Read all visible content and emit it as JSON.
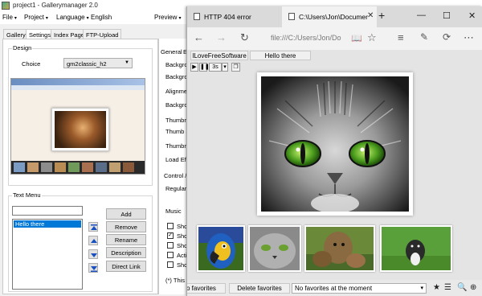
{
  "app": {
    "title": "project1 - Gallerymanager 2.0",
    "menu": [
      {
        "label": "File",
        "chevron": "▾"
      },
      {
        "label": "Project",
        "chevron": "▾"
      },
      {
        "label": "Language",
        "chevron": "▾"
      },
      {
        "label": "English",
        "chevron": ""
      },
      {
        "label": "Preview",
        "chevron": "▾"
      }
    ],
    "tabs": [
      "Gallery",
      "Settings",
      "Index Page",
      "FTP-Upload"
    ],
    "active_tab": "Settings",
    "design": {
      "group_label": "Design",
      "choice_label": "Choice",
      "choice_value": "gm2classic_h2"
    },
    "text_menu": {
      "group_label": "Text Menu",
      "input_value": "",
      "items": [
        "Hello there"
      ],
      "buttons": {
        "add": "Add",
        "remove": "Remove",
        "rename": "Rename",
        "description": "Description",
        "direct_link": "Direct Link"
      }
    },
    "right_panel": {
      "tab_general": "General",
      "tab_e": "E",
      "rows": [
        "Backgrou",
        "Backgro",
        "Alignmen",
        "Backgro",
        "Thumbna",
        "Thumb S",
        "Thumbn",
        "Load Eff",
        "Control /",
        "Regular"
      ],
      "music_label": "Music",
      "checks": [
        {
          "label": "Sho",
          "checked": false
        },
        {
          "label": "Sho",
          "checked": true
        },
        {
          "label": "Sho",
          "checked": false
        },
        {
          "label": "Acti",
          "checked": false
        },
        {
          "label": "Sho",
          "checked": false
        }
      ],
      "footnote": "(*) This p"
    }
  },
  "browser": {
    "tabs": [
      {
        "label": "HTTP 404 error",
        "active": false
      },
      {
        "label": "C:\\Users\\Jon\\Documer",
        "active": true
      }
    ],
    "new_tab": "+",
    "address": "file:///C:/Users/Jon/Do",
    "gallery_menu": [
      "ILoveFreeSoftware",
      "Hello there"
    ],
    "slideshow": {
      "play": "▶",
      "pause": "❚❚",
      "interval": "3s",
      "interval_arrow": "▾"
    },
    "thumbnails": [
      "parrot",
      "kitten",
      "dogs",
      "puppy"
    ],
    "bottom_bar": {
      "favorites_btn": "o favorites",
      "delete_favorites": "Delete favorites",
      "favorites_status": "No favorites at the moment",
      "status_arrow": "▾"
    }
  }
}
